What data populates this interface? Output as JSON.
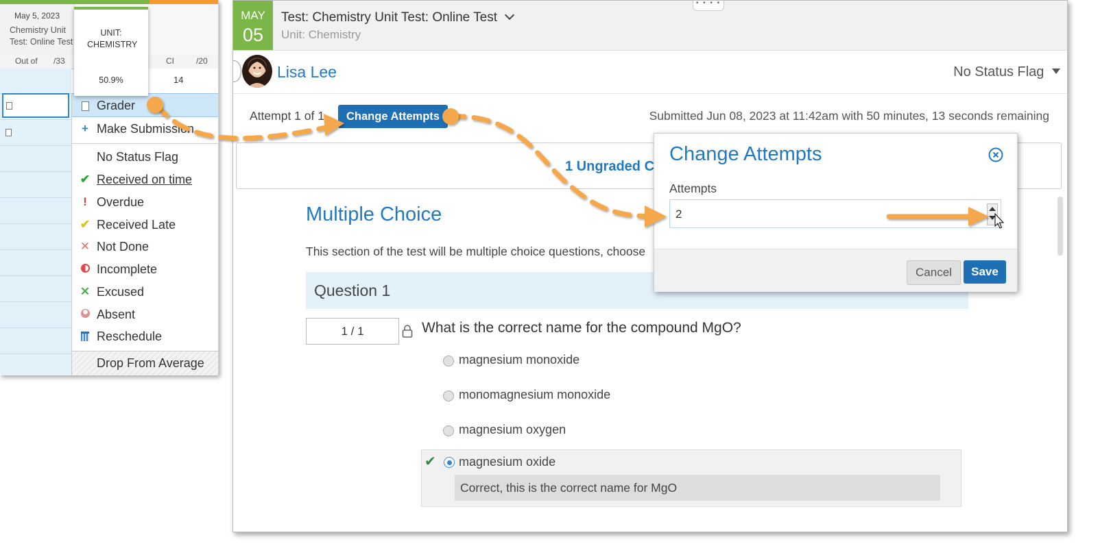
{
  "gradebook": {
    "column_date": "May 5, 2023",
    "column_name_line1": "Chemistry Unit",
    "column_name_line2": "Test: Online Test",
    "unit_header": "UNIT: CHEMISTRY",
    "unit_percent": "50.9%",
    "out_of_label": "Out of",
    "out_of_value": "/33",
    "ci_label": "CI",
    "ci_out_of": "/20",
    "ci_value": "14"
  },
  "context_menu": {
    "items": [
      {
        "label": "Grader",
        "icon": "document-icon"
      },
      {
        "label": "Make Submission",
        "icon": "plus-icon"
      },
      {
        "label": "No Status Flag",
        "icon": ""
      },
      {
        "label": "Received on time",
        "icon": "check-icon"
      },
      {
        "label": "Overdue",
        "icon": "exclamation-icon"
      },
      {
        "label": "Received Late",
        "icon": "late-check-icon"
      },
      {
        "label": "Not Done",
        "icon": "x-icon"
      },
      {
        "label": "Incomplete",
        "icon": "half-circle-icon"
      },
      {
        "label": "Excused",
        "icon": "x-icon"
      },
      {
        "label": "Absent",
        "icon": "person-icon"
      },
      {
        "label": "Reschedule",
        "icon": "calendar-icon"
      },
      {
        "label": "Drop From Average",
        "icon": ""
      }
    ]
  },
  "header": {
    "month": "MAY",
    "day": "05",
    "title": "Test: Chemistry Unit Test: Online Test",
    "unit": "Unit: Chemistry"
  },
  "student": {
    "name": "Lisa Lee",
    "status_flag": "No Status Flag"
  },
  "attempts": {
    "attempt_text": "Attempt 1 of 1",
    "change_button": "Change Attempts",
    "submitted": "Submitted Jun 08, 2023 at 11:42am with 50 minutes, 13 seconds remaining"
  },
  "ungraded": "1 Ungraded C",
  "section": {
    "title": "Multiple Choice",
    "description": "This section of the test will be multiple choice questions, choose"
  },
  "question": {
    "heading": "Question 1",
    "score": "1 / 1",
    "text": "What is the correct name for the compound MgO?",
    "options": [
      "magnesium monoxide",
      "monomagnesium monoxide",
      "magnesium oxygen",
      "magnesium oxide"
    ],
    "selected_index": 3,
    "feedback": "Correct, this is the correct name for MgO"
  },
  "dialog": {
    "title": "Change Attempts",
    "field_label": "Attempts",
    "field_value": "2",
    "cancel": "Cancel",
    "save": "Save"
  },
  "colors": {
    "accent_blue": "#1f78c1",
    "button_blue": "#1f6fb5",
    "date_green": "#7ab648",
    "annotation_orange": "#f5a84b"
  }
}
